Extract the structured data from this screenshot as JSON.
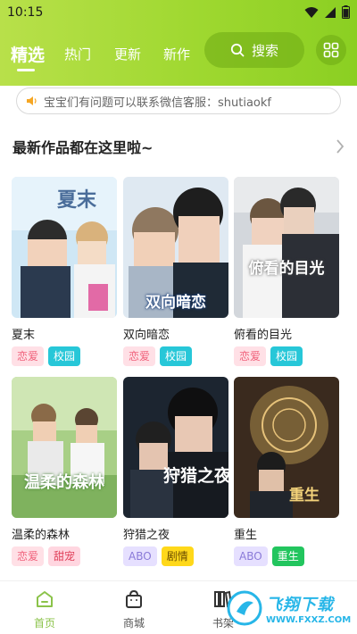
{
  "status": {
    "time": "10:15"
  },
  "tabs": [
    {
      "label": "精选",
      "active": true
    },
    {
      "label": "热门"
    },
    {
      "label": "更新"
    },
    {
      "label": "新作"
    }
  ],
  "search": {
    "label": "搜索"
  },
  "notice": {
    "text": "宝宝们有问题可以联系微信客服：shutiaokf"
  },
  "section": {
    "title": "最新作品都在这里啦~"
  },
  "cards": [
    {
      "title": "夏末",
      "cover_text": "夏末",
      "tags": [
        {
          "label": "恋爱",
          "style": "pink"
        },
        {
          "label": "校园",
          "style": "cyan"
        }
      ]
    },
    {
      "title": "双向暗恋",
      "cover_text": "双向暗恋",
      "tags": [
        {
          "label": "恋爱",
          "style": "pink"
        },
        {
          "label": "校园",
          "style": "cyan"
        }
      ]
    },
    {
      "title": "俯看的目光",
      "cover_text": "俯看的目光",
      "tags": [
        {
          "label": "恋爱",
          "style": "pink"
        },
        {
          "label": "校园",
          "style": "cyan"
        }
      ]
    },
    {
      "title": "温柔的森林",
      "cover_text": "温柔的森林",
      "tags": [
        {
          "label": "恋爱",
          "style": "pink"
        },
        {
          "label": "甜宠",
          "style": "pinkstrong"
        }
      ]
    },
    {
      "title": "狩猎之夜",
      "cover_text": "狩猎之夜",
      "tags": [
        {
          "label": "ABO",
          "style": "lavender"
        },
        {
          "label": "剧情",
          "style": "yellow"
        }
      ]
    },
    {
      "title": "重生",
      "cover_text": "重生",
      "tags": [
        {
          "label": "ABO",
          "style": "lavender"
        },
        {
          "label": "重生",
          "style": "green"
        }
      ]
    }
  ],
  "bottom_nav": [
    {
      "label": "首页",
      "icon": "home-icon",
      "active": true
    },
    {
      "label": "商城",
      "icon": "bag-icon"
    },
    {
      "label": "书架",
      "icon": "bookshelf-icon"
    }
  ],
  "watermark": {
    "text": "飞翔下载",
    "url": "WWW.FXXZ.COM"
  },
  "colors": {
    "accent": "#8bcf22",
    "active_nav": "#8bc34a",
    "tag_pink_bg": "#ffe0e6",
    "tag_pink_fg": "#f0607a",
    "tag_cyan_bg": "#27c7d8",
    "tag_cyan_fg": "#ffffff",
    "tag_lavender_bg": "#e6e0ff",
    "tag_lavender_fg": "#8a7ad8",
    "tag_yellow_bg": "#ffd81a",
    "tag_yellow_fg": "#6b4d00",
    "tag_green_bg": "#22c55e",
    "tag_green_fg": "#ffffff",
    "tag_pinkstrong_bg": "#ffd6e0",
    "tag_pinkstrong_fg": "#e0405a"
  }
}
